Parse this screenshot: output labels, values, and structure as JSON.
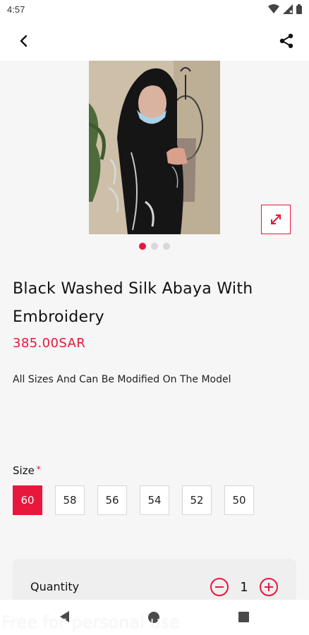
{
  "status_bar": {
    "time": "4:57"
  },
  "product": {
    "title": "Black Washed Silk Abaya With Embroidery",
    "price": "385.00SAR",
    "description": "All Sizes And Can Be Modified On The Model",
    "gallery": {
      "image_count": 3,
      "active_index": 0
    }
  },
  "size": {
    "label": "Size",
    "required_marker": "*",
    "options": [
      "60",
      "58",
      "56",
      "54",
      "52",
      "50"
    ],
    "selected": "60"
  },
  "quantity": {
    "label": "Quantity",
    "value": "1"
  },
  "watermark": "Free for personal use",
  "colors": {
    "accent": "#e8173c",
    "background": "#f6f6f6"
  },
  "icons": {
    "back": "arrow-back-icon",
    "share": "share-icon",
    "expand": "expand-icon",
    "minus": "minus-circle-icon",
    "plus": "plus-circle-icon"
  }
}
